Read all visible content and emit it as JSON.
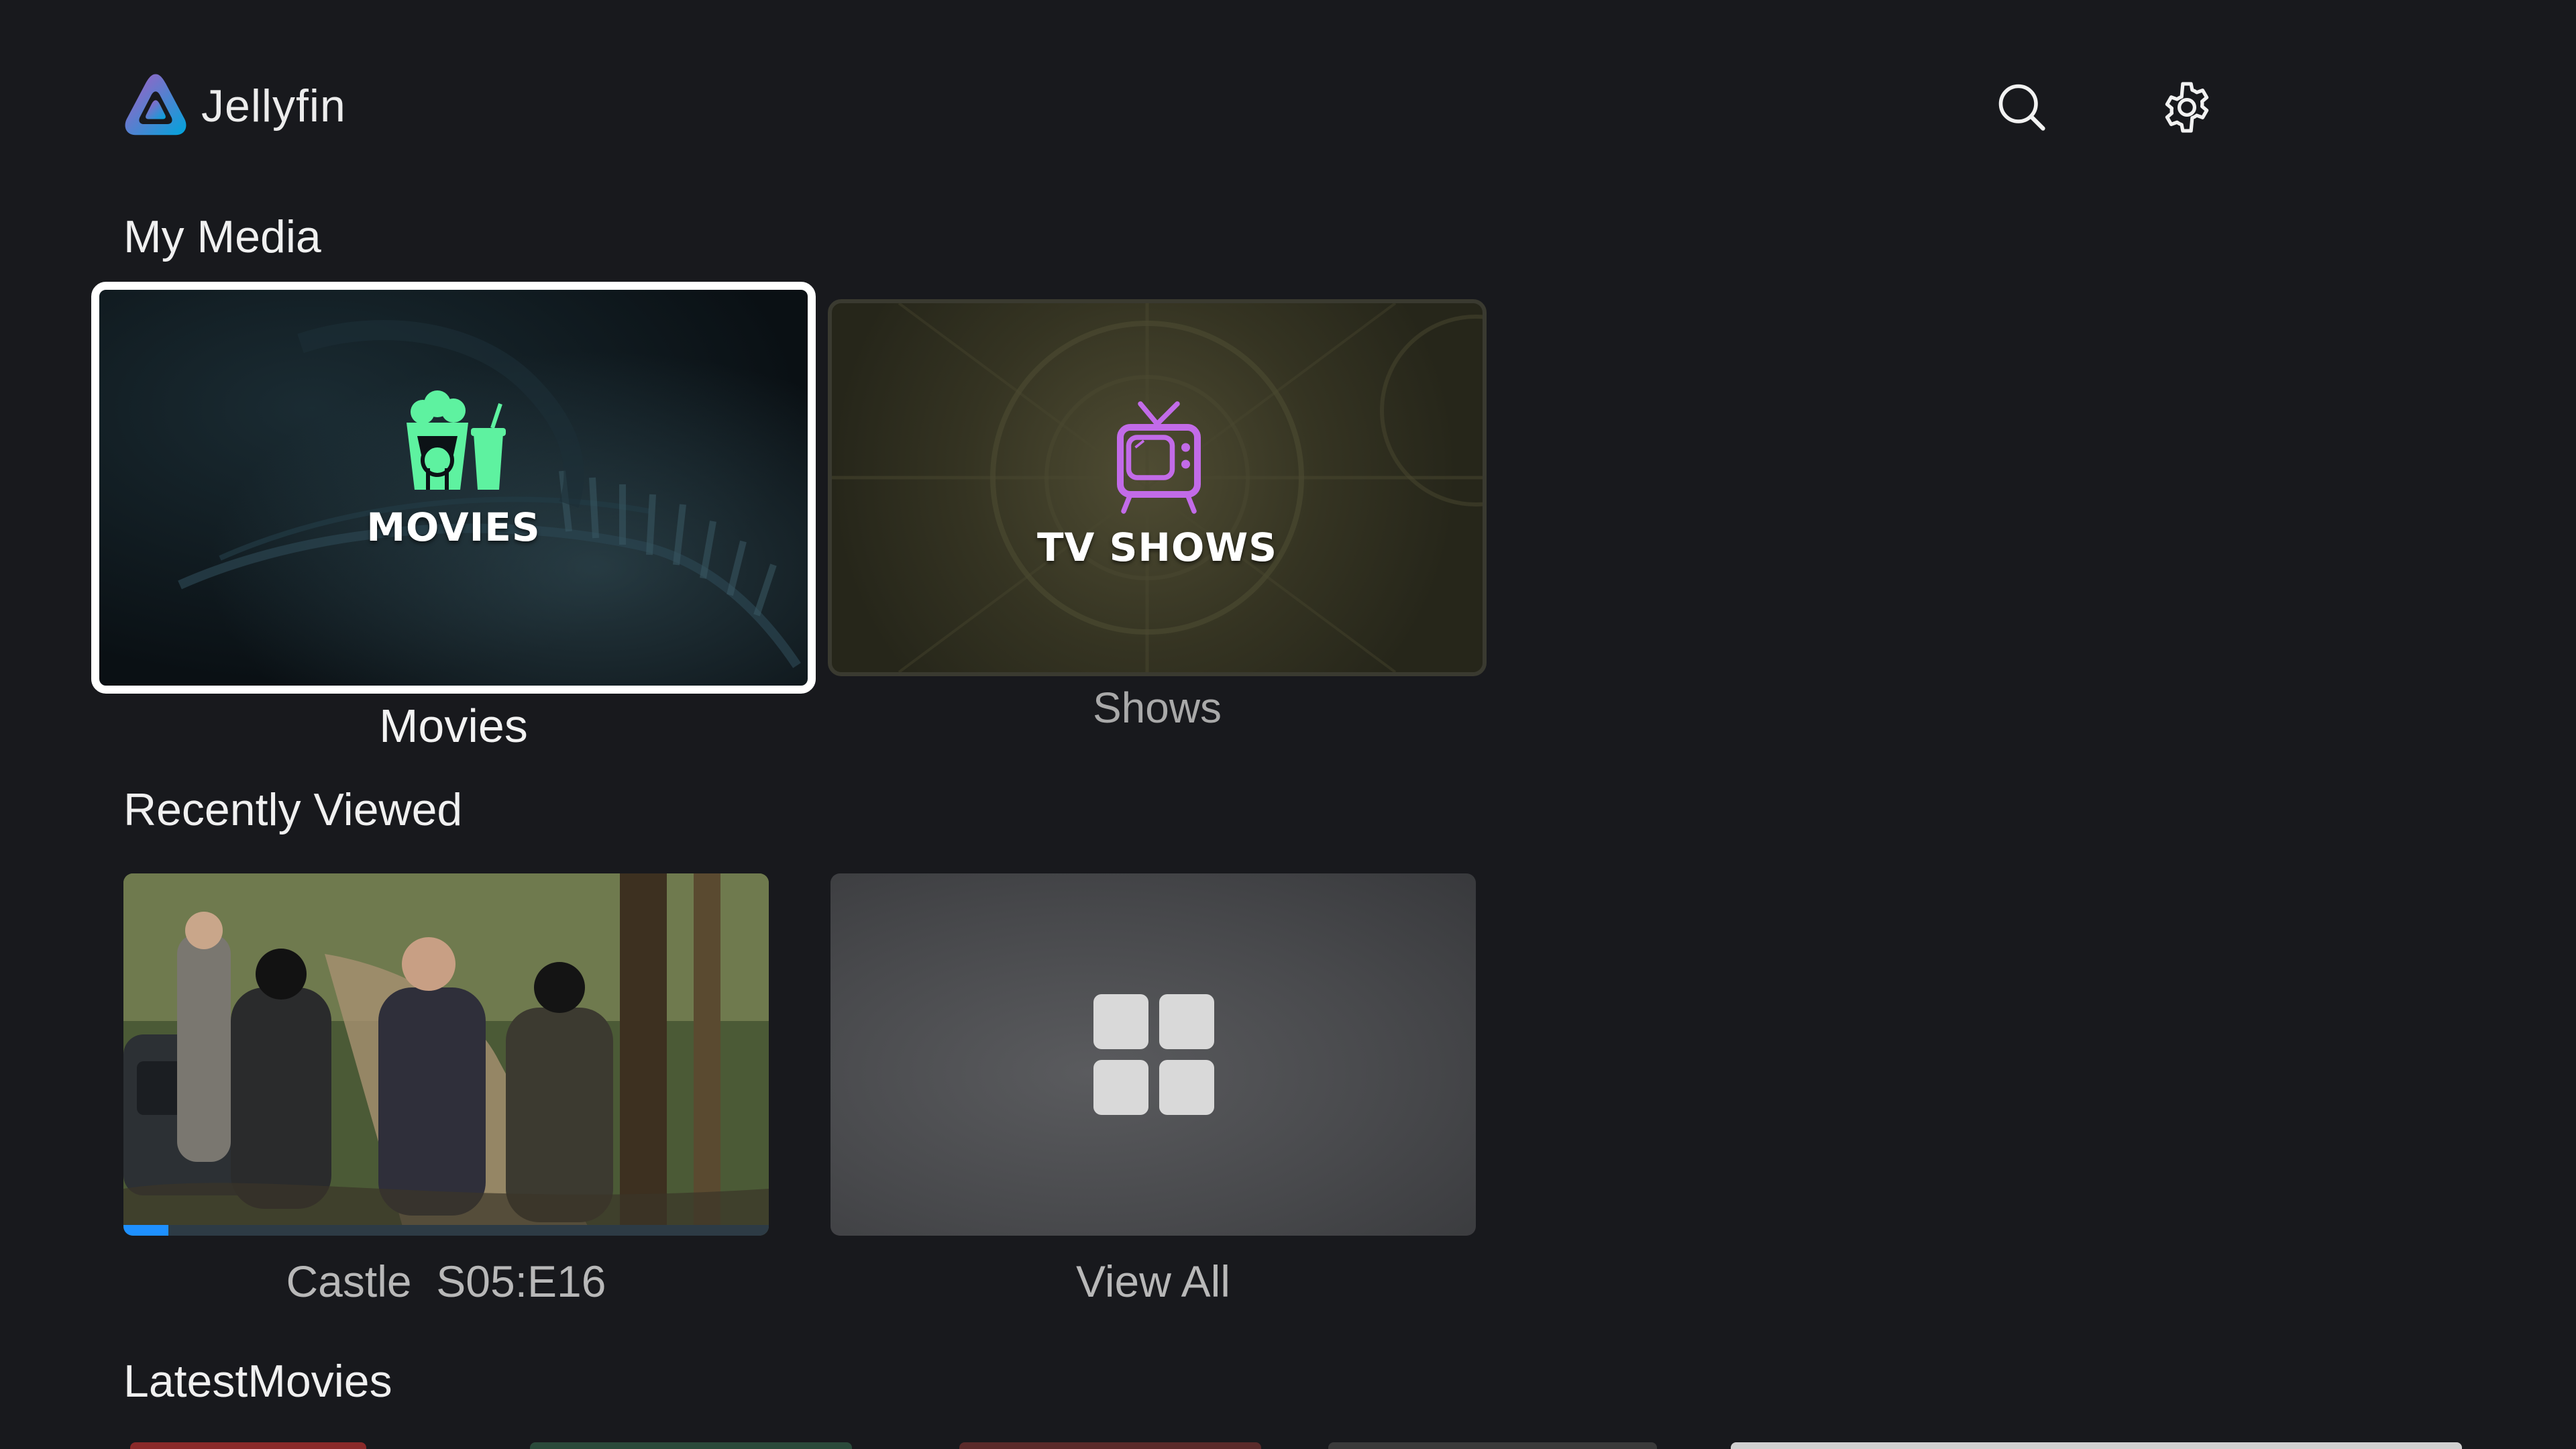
{
  "app": {
    "name": "Jellyfin",
    "accent_colors": [
      "#aa5cc3",
      "#00a4dc"
    ]
  },
  "header": {
    "search_icon": "search-icon",
    "settings_icon": "gear-icon"
  },
  "sections": {
    "my_media": {
      "title": "My Media",
      "libraries": [
        {
          "overlay_label": "MOVIES",
          "caption": "Movies",
          "icon": "popcorn-icon",
          "icon_color": "#5ef2a0",
          "focused": true
        },
        {
          "overlay_label": "TV SHOWS",
          "caption": "Shows",
          "icon": "tv-icon",
          "icon_color": "#c26be8",
          "focused": false
        }
      ]
    },
    "recently_viewed": {
      "title": "Recently Viewed",
      "items": [
        {
          "caption": "Castle  S05:E16",
          "progress": 0.07,
          "progress_color": "#1e90ff"
        },
        {
          "caption": "View All",
          "icon": "grid-icon"
        }
      ]
    },
    "latest_movies": {
      "title": "LatestMovies"
    }
  }
}
